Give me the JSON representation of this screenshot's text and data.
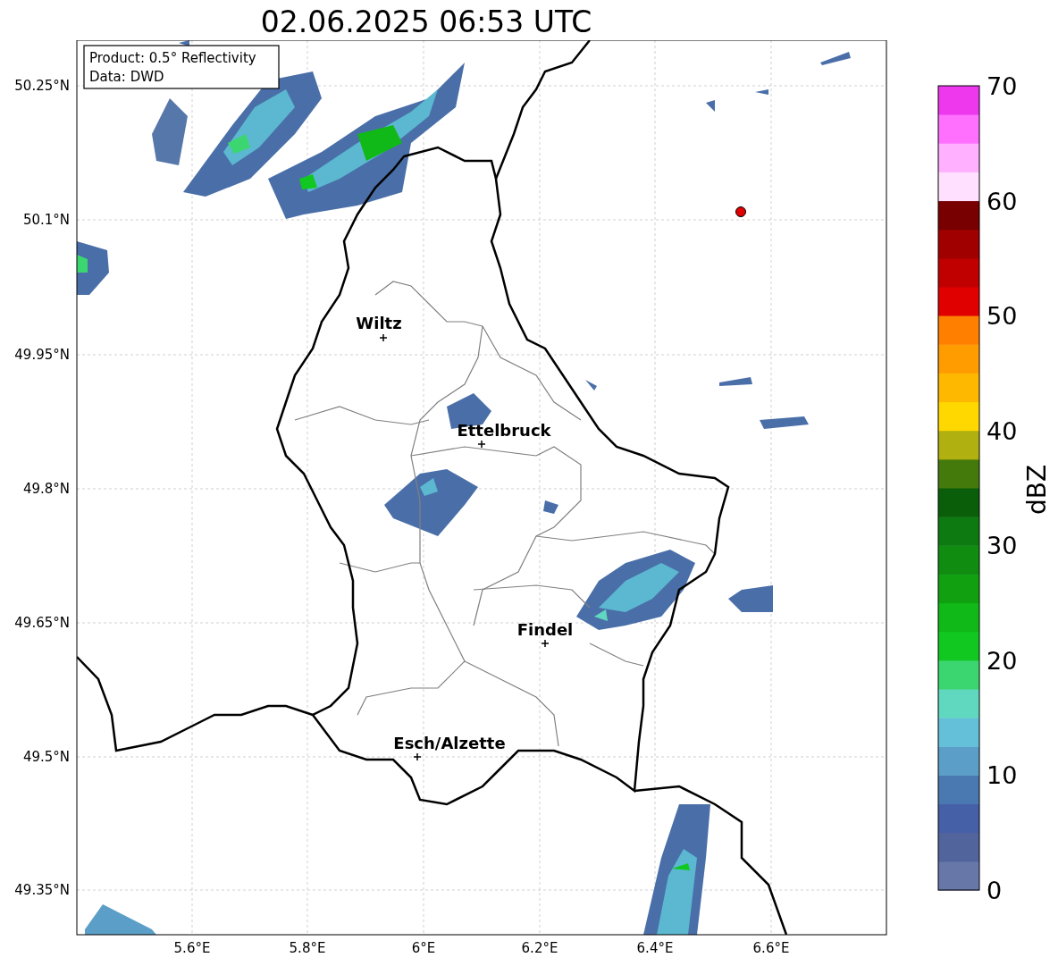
{
  "title": "02.06.2025 06:53 UTC",
  "info_box": [
    "Product: 0.5° Reflectivity",
    "Data: DWD"
  ],
  "y_ticks": [
    "50.25°N",
    "50.1°N",
    "49.95°N",
    "49.8°N",
    "49.65°N",
    "49.5°N",
    "49.35°N"
  ],
  "x_ticks": [
    "5.6°E",
    "5.8°E",
    "6°E",
    "6.2°E",
    "6.4°E",
    "6.6°E"
  ],
  "cities": [
    {
      "name": "Wiltz"
    },
    {
      "name": "Ettelbruck"
    },
    {
      "name": "Findel"
    },
    {
      "name": "Esch/Alzette"
    }
  ],
  "colorbar": {
    "label": "dBZ",
    "ticks": [
      "70",
      "60",
      "50",
      "40",
      "30",
      "20",
      "10",
      "0"
    ],
    "segments": [
      {
        "color": "#6677a8"
      },
      {
        "color": "#52649c"
      },
      {
        "color": "#4560a6"
      },
      {
        "color": "#4a78b0"
      },
      {
        "color": "#5b9ec8"
      },
      {
        "color": "#64c0d8"
      },
      {
        "color": "#60d8c0"
      },
      {
        "color": "#3cd670"
      },
      {
        "color": "#10c820"
      },
      {
        "color": "#10b818"
      },
      {
        "color": "#10a010"
      },
      {
        "color": "#108c10"
      },
      {
        "color": "#0c7a10"
      },
      {
        "color": "#0a5e0a"
      },
      {
        "color": "#447a0c"
      },
      {
        "color": "#b0b010"
      },
      {
        "color": "#ffd800"
      },
      {
        "color": "#ffb800"
      },
      {
        "color": "#ff9c00"
      },
      {
        "color": "#ff8000"
      },
      {
        "color": "#e00000"
      },
      {
        "color": "#c00000"
      },
      {
        "color": "#a00000"
      },
      {
        "color": "#780000"
      },
      {
        "color": "#ffe0ff"
      },
      {
        "color": "#ffb0ff"
      },
      {
        "color": "#ff70ff"
      },
      {
        "color": "#ee38ee"
      }
    ]
  }
}
